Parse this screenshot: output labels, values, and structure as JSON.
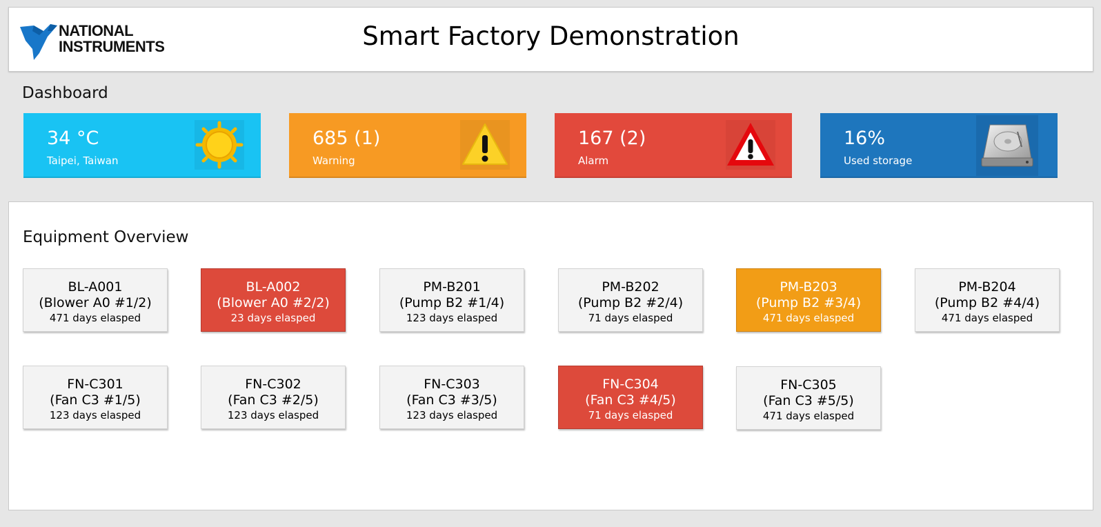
{
  "header": {
    "logo_line1": "NATIONAL",
    "logo_line2": "INSTRUMENTS",
    "title": "Smart Factory Demonstration"
  },
  "dashboard": {
    "label": "Dashboard",
    "tiles": [
      {
        "value": "34 °C",
        "caption": "Taipei, Taiwan",
        "icon": "sun-icon",
        "color": "#19c3f3"
      },
      {
        "value": "685 (1)",
        "caption": "Warning",
        "icon": "warning-icon",
        "color": "#f79a23"
      },
      {
        "value": "167 (2)",
        "caption": "Alarm",
        "icon": "alarm-triangle-icon",
        "color": "#e2493c"
      },
      {
        "value": "16%",
        "caption": "Used storage",
        "icon": "hard-drive-icon",
        "color": "#1e76bd"
      }
    ]
  },
  "equipment": {
    "label": "Equipment Overview",
    "items": [
      {
        "id": "BL-A001",
        "desc": "(Blower A0 #1/2)",
        "days": "471 days elasped",
        "status": "normal"
      },
      {
        "id": "BL-A002",
        "desc": "(Blower A0 #2/2)",
        "days": "23 days elasped",
        "status": "alarm"
      },
      {
        "id": "PM-B201",
        "desc": "(Pump B2 #1/4)",
        "days": "123 days elasped",
        "status": "normal"
      },
      {
        "id": "PM-B202",
        "desc": "(Pump B2 #2/4)",
        "days": "71 days elasped",
        "status": "normal"
      },
      {
        "id": "PM-B203",
        "desc": "(Pump B2 #3/4)",
        "days": "471 days elasped",
        "status": "warning"
      },
      {
        "id": "PM-B204",
        "desc": "(Pump B2 #4/4)",
        "days": "471 days elasped",
        "status": "normal"
      },
      {
        "id": "FN-C301",
        "desc": "(Fan C3 #1/5)",
        "days": "123 days elasped",
        "status": "normal"
      },
      {
        "id": "FN-C302",
        "desc": "(Fan C3 #2/5)",
        "days": "123 days elasped",
        "status": "normal"
      },
      {
        "id": "FN-C303",
        "desc": "(Fan C3 #3/5)",
        "days": "123 days elasped",
        "status": "normal"
      },
      {
        "id": "FN-C304",
        "desc": "(Fan C3 #4/5)",
        "days": "71 days elasped",
        "status": "alarm"
      },
      {
        "id": "FN-C305",
        "desc": "(Fan C3 #5/5)",
        "days": "471 days elasped",
        "status": "normal"
      }
    ]
  },
  "colors": {
    "alarm": "#dd4a3b",
    "warning": "#f29d16",
    "normal": "#f3f3f3"
  }
}
